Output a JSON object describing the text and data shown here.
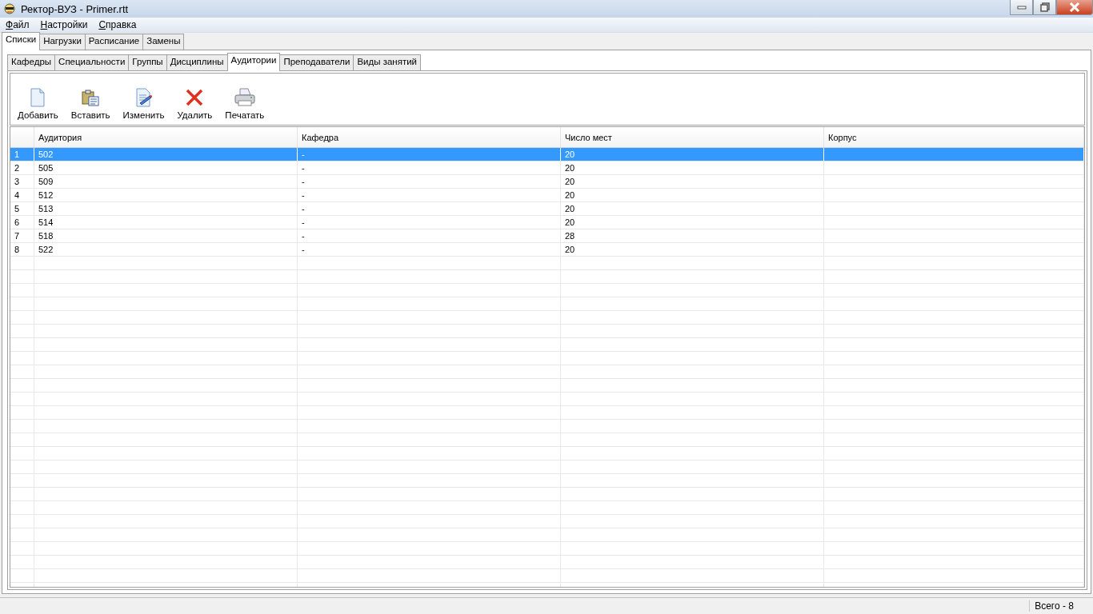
{
  "window": {
    "title": "Ректор-ВУЗ - Primer.rtt"
  },
  "menu": [
    "Файл",
    "Настройки",
    "Справка"
  ],
  "tabs": [
    {
      "label": "Списки",
      "selected": true
    },
    {
      "label": "Нагрузки",
      "selected": false
    },
    {
      "label": "Расписание",
      "selected": false
    },
    {
      "label": "Замены",
      "selected": false
    }
  ],
  "subtabs": [
    {
      "label": "Кафедры",
      "selected": false
    },
    {
      "label": "Специальности",
      "selected": false
    },
    {
      "label": "Группы",
      "selected": false
    },
    {
      "label": "Дисциплины",
      "selected": false
    },
    {
      "label": "Аудитории",
      "selected": true
    },
    {
      "label": "Преподаватели",
      "selected": false
    },
    {
      "label": "Виды занятий",
      "selected": false
    }
  ],
  "toolbar": [
    {
      "kind": "add",
      "label": "Добавить"
    },
    {
      "kind": "paste",
      "label": "Вставить"
    },
    {
      "kind": "edit",
      "label": "Изменить"
    },
    {
      "kind": "delete",
      "label": "Удалить"
    },
    {
      "kind": "print",
      "label": "Печатать"
    }
  ],
  "table": {
    "columns": [
      "Аудитория",
      "Кафедра",
      "Число мест",
      "Корпус"
    ],
    "rows": [
      {
        "num": "1",
        "cells": [
          "502",
          "-",
          "20"
        ],
        "selected": true
      },
      {
        "num": "2",
        "cells": [
          "505",
          "-",
          "20"
        ],
        "selected": false
      },
      {
        "num": "3",
        "cells": [
          "509",
          "-",
          "20"
        ],
        "selected": false
      },
      {
        "num": "4",
        "cells": [
          "512",
          "-",
          "20"
        ],
        "selected": false
      },
      {
        "num": "5",
        "cells": [
          "513",
          "-",
          "20"
        ],
        "selected": false
      },
      {
        "num": "6",
        "cells": [
          "514",
          "-",
          "20"
        ],
        "selected": false
      },
      {
        "num": "7",
        "cells": [
          "518",
          "-",
          "28"
        ],
        "selected": false
      },
      {
        "num": "8",
        "cells": [
          "522",
          "-",
          "20"
        ],
        "selected": false
      }
    ]
  },
  "status_bar": {
    "total": "Всего - 8"
  }
}
